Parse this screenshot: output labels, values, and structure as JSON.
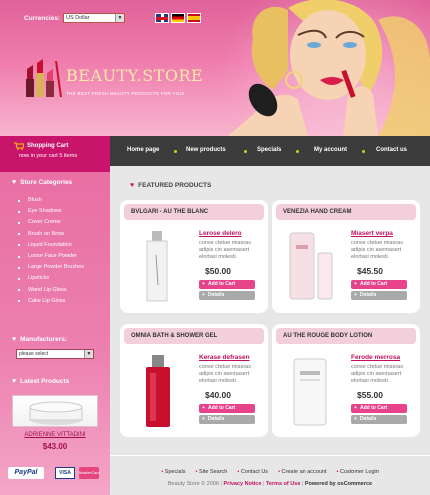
{
  "header": {
    "currency_label": "Currencies:",
    "currency_value": "US Dollar",
    "languages": [
      "English",
      "Deutsch",
      "Español"
    ],
    "logo_title": "BEAUTY.STORE",
    "logo_tagline": "THE BEST FRESH BEAUTY PRODUCTS FOR YOU!"
  },
  "cart": {
    "title": "Shopping Cart",
    "status": "now in your cart 5 items"
  },
  "nav": {
    "items": [
      "Home page",
      "New products",
      "Specials",
      "My account",
      "Contact us"
    ]
  },
  "sidebar": {
    "categories_title": "Store Categories",
    "categories": [
      "Blush",
      "Eye Shadows",
      "Cover Creme",
      "Brush on Brow",
      "Liquid Foundation",
      "Loose Face Powder",
      "Large Powder Brushes",
      "Lipsticks",
      "Wand Lip Gloss",
      "Cake Lip Gloss"
    ],
    "manufacturers_title": "Manufacturers:",
    "manufacturers_value": "please select",
    "latest_title": "Latest Products",
    "latest_name": "ADRIENNE VITTADINI",
    "latest_price": "$43.00"
  },
  "main": {
    "featured_title": "FEATURED PRODUCTS",
    "products": [
      {
        "title": "BVLGARI - AU THE BLANC",
        "name": "Lerose delero",
        "desc": "conse ctetue miasras adipis cin asemasert elortasi molesti.",
        "price": "$50.00"
      },
      {
        "title": "VENEZIA HAND CREAM",
        "name": "Miasert verpa",
        "desc": "conse ctetue miasras adipis cin asemasert elortasi molesti.",
        "price": "$45.50"
      },
      {
        "title": "OMNIA BATH & SHOWER GEL",
        "name": "Kerase defrasen",
        "desc": "conse ctetue miasras adipis cin asemasert elortasi molesti.",
        "price": "$40.00"
      },
      {
        "title": "AU THE ROUGE BODY LOTION",
        "name": "Ferode merrosa",
        "desc": "conse ctetue miasras adipis cin asemasert elortasi molesti.",
        "price": "$55.00"
      }
    ],
    "add_label": "Add to Cart",
    "details_label": "Details"
  },
  "footer": {
    "links": [
      "Specials",
      "Site Search",
      "Contact Us",
      "Create an account",
      "Customer Login"
    ],
    "copyright": "Beauty Store © 2006",
    "privacy": "Privacy Notice",
    "terms": "Terms of Use",
    "powered": "Powered by osCommerce"
  },
  "payment": {
    "paypal": "PayPal",
    "visa": "VISA",
    "mastercard": "MasterCard"
  },
  "colors": {
    "brand_pink": "#e6438a",
    "nav_dark": "#3c3c3c",
    "cart_magenta": "#c8146a",
    "nav_dot": "#c9d21a"
  }
}
